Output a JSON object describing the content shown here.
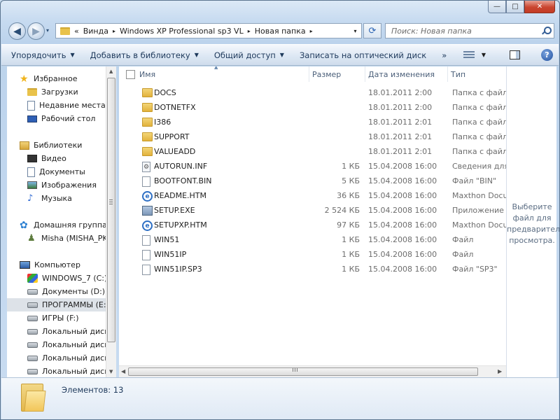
{
  "window": {
    "controls": {
      "minimize": "—",
      "maximize": "□",
      "close": "✕"
    }
  },
  "nav": {
    "back_glyph": "◀",
    "forward_glyph": "▶",
    "history_glyph": "▾"
  },
  "address": {
    "prefix": "«",
    "crumbs": [
      "Винда",
      "Windows XP Professional sp3 VL",
      "Новая папка"
    ],
    "separator": "▸",
    "refresh_glyph": "⟳"
  },
  "search": {
    "placeholder": "Поиск: Новая папка"
  },
  "toolbar": {
    "organize": "Упорядочить",
    "add_to_library": "Добавить в библиотеку",
    "share": "Общий доступ",
    "burn": "Записать на оптический диск",
    "more": "»",
    "dropdown_glyph": "▼",
    "help": "?"
  },
  "sidebar": {
    "items": [
      {
        "label": "Избранное",
        "icon": "star-icon"
      },
      {
        "label": "Загрузки",
        "icon": "downloads-folder-icon"
      },
      {
        "label": "Недавние места",
        "icon": "recent-places-icon"
      },
      {
        "label": "Рабочий стол",
        "icon": "desktop-icon"
      },
      {
        "label": "Библиотеки",
        "icon": "libraries-icon"
      },
      {
        "label": "Видео",
        "icon": "video-library-icon"
      },
      {
        "label": "Документы",
        "icon": "documents-library-icon"
      },
      {
        "label": "Изображения",
        "icon": "pictures-library-icon"
      },
      {
        "label": "Музыка",
        "icon": "music-library-icon"
      },
      {
        "label": "Домашняя группа",
        "icon": "homegroup-icon"
      },
      {
        "label": "Misha (MISHA_PK)",
        "icon": "user-icon"
      },
      {
        "label": "Компьютер",
        "icon": "computer-icon"
      },
      {
        "label": "WINDOWS_7 (C:)",
        "icon": "system-drive-icon"
      },
      {
        "label": "Документы (D:)",
        "icon": "drive-icon"
      },
      {
        "label": "ПРОГРАММЫ (E:)",
        "icon": "drive-icon"
      },
      {
        "label": "ИГРЫ (F:)",
        "icon": "drive-icon"
      },
      {
        "label": "Локальный диск (",
        "icon": "drive-icon"
      },
      {
        "label": "Локальный диск (",
        "icon": "drive-icon"
      },
      {
        "label": "Локальный диск (",
        "icon": "drive-icon"
      },
      {
        "label": "Локальный диск (",
        "icon": "drive-icon"
      }
    ],
    "selected_index": 14
  },
  "columns": {
    "name": "Имя",
    "size": "Размер",
    "modified": "Дата изменения",
    "type": "Тип"
  },
  "files": [
    {
      "name": "DOCS",
      "size": "",
      "date": "18.01.2011 2:00",
      "type": "Папка с файлами",
      "icon": "folder-icon"
    },
    {
      "name": "DOTNETFX",
      "size": "",
      "date": "18.01.2011 2:00",
      "type": "Папка с файлами",
      "icon": "folder-icon"
    },
    {
      "name": "I386",
      "size": "",
      "date": "18.01.2011 2:01",
      "type": "Папка с файлами",
      "icon": "folder-icon"
    },
    {
      "name": "SUPPORT",
      "size": "",
      "date": "18.01.2011 2:01",
      "type": "Папка с файлами",
      "icon": "folder-icon"
    },
    {
      "name": "VALUEADD",
      "size": "",
      "date": "18.01.2011 2:01",
      "type": "Папка с файлами",
      "icon": "folder-icon"
    },
    {
      "name": "AUTORUN.INF",
      "size": "1 КБ",
      "date": "15.04.2008 16:00",
      "type": "Сведения для у",
      "icon": "settings-file-icon"
    },
    {
      "name": "BOOTFONT.BIN",
      "size": "5 КБ",
      "date": "15.04.2008 16:00",
      "type": "Файл \"BIN\"",
      "icon": "file-icon"
    },
    {
      "name": "README.HTM",
      "size": "36 КБ",
      "date": "15.04.2008 16:00",
      "type": "Maxthon Docum",
      "icon": "html-file-icon"
    },
    {
      "name": "SETUP.EXE",
      "size": "2 524 КБ",
      "date": "15.04.2008 16:00",
      "type": "Приложение",
      "icon": "exe-file-icon"
    },
    {
      "name": "SETUPXP.HTM",
      "size": "97 КБ",
      "date": "15.04.2008 16:00",
      "type": "Maxthon Docum",
      "icon": "html-file-icon"
    },
    {
      "name": "WIN51",
      "size": "1 КБ",
      "date": "15.04.2008 16:00",
      "type": "Файл",
      "icon": "file-icon"
    },
    {
      "name": "WIN51IP",
      "size": "1 КБ",
      "date": "15.04.2008 16:00",
      "type": "Файл",
      "icon": "file-icon"
    },
    {
      "name": "WIN51IP.SP3",
      "size": "1 КБ",
      "date": "15.04.2008 16:00",
      "type": "Файл \"SP3\"",
      "icon": "file-icon"
    }
  ],
  "preview": {
    "text": "Выберите файл для предварительного просмотра."
  },
  "status": {
    "items_count": "Элементов: 13"
  }
}
